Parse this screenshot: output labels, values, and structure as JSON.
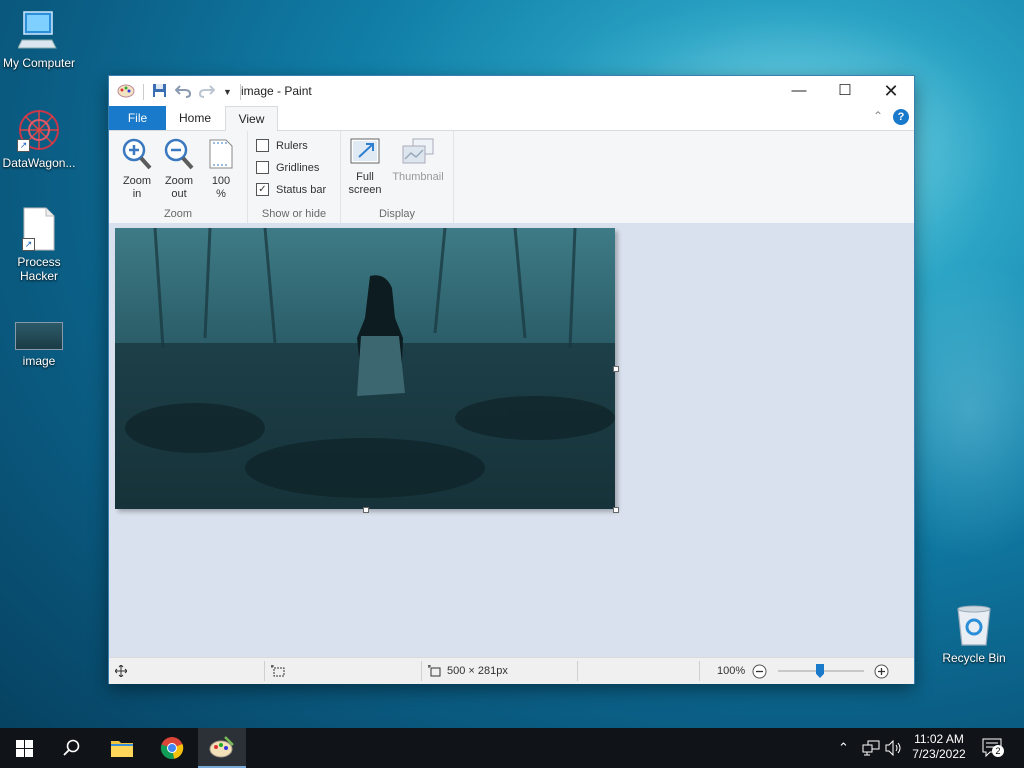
{
  "desktop": {
    "icons": [
      {
        "label": "My Computer"
      },
      {
        "label": "DataWagon..."
      },
      {
        "label": "Process Hacker"
      },
      {
        "label": "image"
      },
      {
        "label": "Recycle Bin"
      }
    ]
  },
  "window": {
    "title": "image - Paint",
    "tabs": {
      "file": "File",
      "home": "Home",
      "view": "View"
    },
    "ribbon": {
      "zoom": {
        "zoom_in": "Zoom in",
        "zoom_out": "Zoom out",
        "hundred": "100 %",
        "label": "Zoom"
      },
      "show_hide": {
        "rulers": {
          "label": "Rulers",
          "checked": false
        },
        "gridlines": {
          "label": "Gridlines",
          "checked": false
        },
        "status_bar": {
          "label": "Status bar",
          "checked": true
        },
        "label": "Show or hide"
      },
      "display": {
        "full_screen": "Full screen",
        "thumbnail": "Thumbnail",
        "label": "Display"
      }
    },
    "statusbar": {
      "dimensions": "500 × 281px",
      "zoom_percent": "100%",
      "zoom_value": 100
    }
  },
  "taskbar": {
    "time": "11:02 AM",
    "date": "7/23/2022",
    "notification_count": "2"
  },
  "colors": {
    "file_tab": "#1979ca",
    "ribbon_bg": "#f5f6f7",
    "canvas_bg": "#d9e1ee",
    "taskbar_bg": "#101418"
  }
}
